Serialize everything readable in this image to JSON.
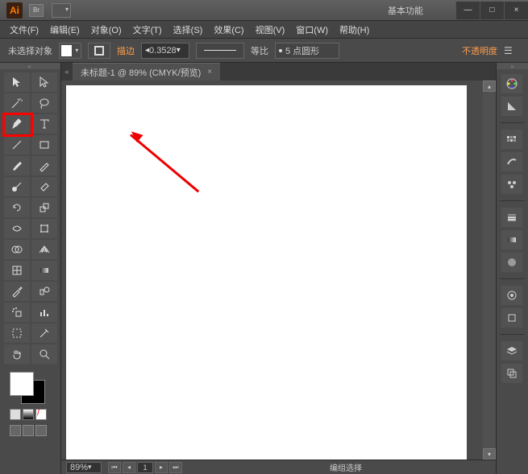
{
  "title": {
    "logo": "Ai",
    "br": "Br",
    "workspace": "基本功能"
  },
  "win": {
    "min": "—",
    "max": "□",
    "close": "×"
  },
  "menus": [
    "文件(F)",
    "编辑(E)",
    "对象(O)",
    "文字(T)",
    "选择(S)",
    "效果(C)",
    "视图(V)",
    "窗口(W)",
    "帮助(H)"
  ],
  "control": {
    "selection_state": "未选择对象",
    "stroke_label": "描边",
    "stroke_value": "0.3528",
    "proportion": "等比",
    "brush_value": "5 点圆形",
    "opacity": "不透明度"
  },
  "tab": {
    "expand": "«",
    "title": "未标题-1 @ 89% (CMYK/预览)",
    "close": "×"
  },
  "status": {
    "zoom": "89%",
    "page": "1",
    "text": "编组选择"
  },
  "panels_right": {
    "expand": "»"
  },
  "tool_icons": {
    "selection": "selection-tool",
    "direct": "direct-selection-tool",
    "wand": "magic-wand-tool",
    "lasso": "lasso-tool",
    "pen": "pen-tool",
    "type": "type-tool",
    "line": "line-segment-tool",
    "rect": "rectangle-tool",
    "brush": "paintbrush-tool",
    "pencil": "pencil-tool",
    "blob": "blob-brush-tool",
    "eraser": "eraser-tool",
    "rotate": "rotate-tool",
    "scale": "scale-tool",
    "width": "width-tool",
    "free": "free-transform-tool",
    "shape": "shape-builder-tool",
    "perspective": "perspective-grid-tool",
    "mesh": "mesh-tool",
    "gradient": "gradient-tool",
    "eyedrop": "eyedropper-tool",
    "blend": "blend-tool",
    "symbol": "symbol-sprayer-tool",
    "graph": "column-graph-tool",
    "artboard": "artboard-tool",
    "slice": "slice-tool",
    "hand": "hand-tool",
    "zoom": "zoom-tool"
  }
}
